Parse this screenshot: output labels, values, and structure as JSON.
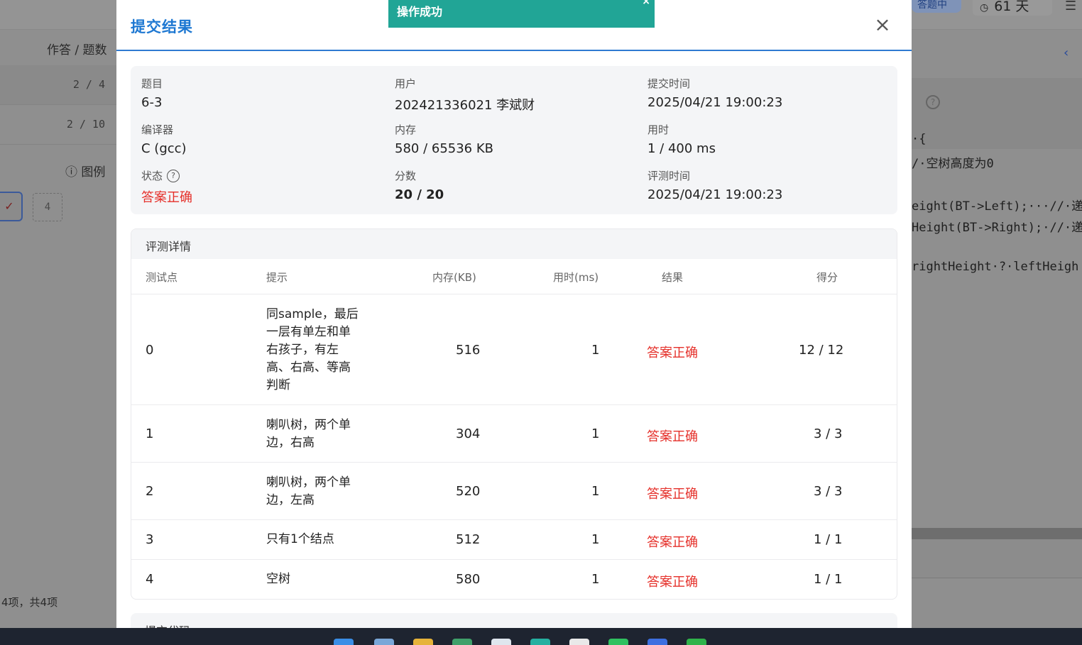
{
  "background": {
    "left_header": "作答 / 题数",
    "rows": [
      "2 / 4",
      "2 / 10"
    ],
    "legend": "图例",
    "box_a_mark": "✓",
    "box_b_label": "4",
    "footer_count": "4项，共4项",
    "right_badge": "答题中",
    "timer": "61 天",
    "code_lines": [
      "·{",
      "/·空树高度为0",
      "eight(BT->Left);···//·递",
      "Height(BT->Right);·//·递",
      "rightHeight·?·leftHeigh"
    ]
  },
  "toast": {
    "text": "操作成功"
  },
  "modal": {
    "title": "提交结果",
    "info": {
      "problem_label": "题目",
      "problem": "6-3",
      "user_label": "用户",
      "user": "202421336021 李斌财",
      "submit_time_label": "提交时间",
      "submit_time": "2025/04/21 19:00:23",
      "compiler_label": "编译器",
      "compiler": "C (gcc)",
      "memory_label": "内存",
      "memory": "580 / 65536 KB",
      "time_label": "用时",
      "time": "1 / 400 ms",
      "status_label": "状态",
      "status": "答案正确",
      "score_label": "分数",
      "score": "20 / 20",
      "judge_time_label": "评测时间",
      "judge_time": "2025/04/21 19:00:23"
    },
    "details": {
      "title": "评测详情",
      "columns": [
        "测试点",
        "提示",
        "内存(KB)",
        "用时(ms)",
        "结果",
        "得分"
      ],
      "rows": [
        {
          "id": "0",
          "hint": "同sample，最后一层有单左和单右孩子，有左高、右高、等高判断",
          "memory": "516",
          "time": "1",
          "result": "答案正确",
          "score": "12 / 12"
        },
        {
          "id": "1",
          "hint": "喇叭树，两个单边，右高",
          "memory": "304",
          "time": "1",
          "result": "答案正确",
          "score": "3 / 3"
        },
        {
          "id": "2",
          "hint": "喇叭树，两个单边，左高",
          "memory": "520",
          "time": "1",
          "result": "答案正确",
          "score": "3 / 3"
        },
        {
          "id": "3",
          "hint": "只有1个结点",
          "memory": "512",
          "time": "1",
          "result": "答案正确",
          "score": "1 / 1"
        },
        {
          "id": "4",
          "hint": "空树",
          "memory": "580",
          "time": "1",
          "result": "答案正确",
          "score": "1 / 1"
        }
      ]
    },
    "code_section": "提交代码"
  },
  "colors": {
    "accent": "#1e78d2",
    "success_toast": "#21a596",
    "ok_text": "#e5302a"
  }
}
